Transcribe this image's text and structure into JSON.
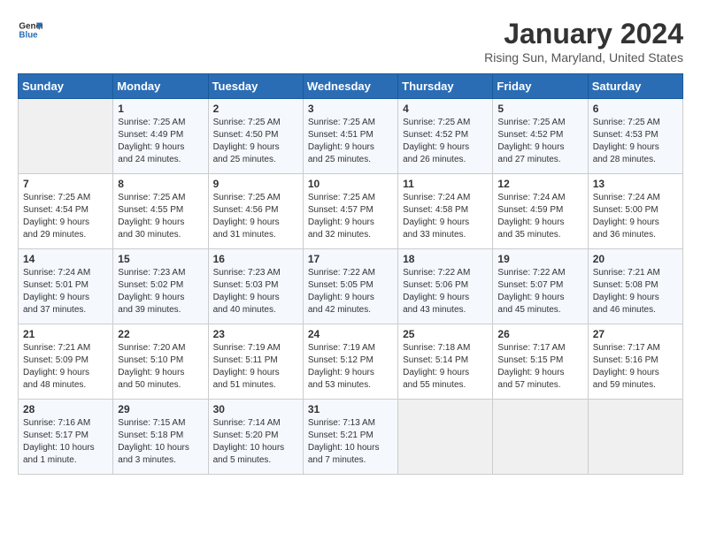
{
  "logo": {
    "line1": "General",
    "line2": "Blue"
  },
  "title": "January 2024",
  "location": "Rising Sun, Maryland, United States",
  "days_of_week": [
    "Sunday",
    "Monday",
    "Tuesday",
    "Wednesday",
    "Thursday",
    "Friday",
    "Saturday"
  ],
  "weeks": [
    [
      {
        "day": "",
        "info": ""
      },
      {
        "day": "1",
        "info": "Sunrise: 7:25 AM\nSunset: 4:49 PM\nDaylight: 9 hours\nand 24 minutes."
      },
      {
        "day": "2",
        "info": "Sunrise: 7:25 AM\nSunset: 4:50 PM\nDaylight: 9 hours\nand 25 minutes."
      },
      {
        "day": "3",
        "info": "Sunrise: 7:25 AM\nSunset: 4:51 PM\nDaylight: 9 hours\nand 25 minutes."
      },
      {
        "day": "4",
        "info": "Sunrise: 7:25 AM\nSunset: 4:52 PM\nDaylight: 9 hours\nand 26 minutes."
      },
      {
        "day": "5",
        "info": "Sunrise: 7:25 AM\nSunset: 4:52 PM\nDaylight: 9 hours\nand 27 minutes."
      },
      {
        "day": "6",
        "info": "Sunrise: 7:25 AM\nSunset: 4:53 PM\nDaylight: 9 hours\nand 28 minutes."
      }
    ],
    [
      {
        "day": "7",
        "info": "Sunrise: 7:25 AM\nSunset: 4:54 PM\nDaylight: 9 hours\nand 29 minutes."
      },
      {
        "day": "8",
        "info": "Sunrise: 7:25 AM\nSunset: 4:55 PM\nDaylight: 9 hours\nand 30 minutes."
      },
      {
        "day": "9",
        "info": "Sunrise: 7:25 AM\nSunset: 4:56 PM\nDaylight: 9 hours\nand 31 minutes."
      },
      {
        "day": "10",
        "info": "Sunrise: 7:25 AM\nSunset: 4:57 PM\nDaylight: 9 hours\nand 32 minutes."
      },
      {
        "day": "11",
        "info": "Sunrise: 7:24 AM\nSunset: 4:58 PM\nDaylight: 9 hours\nand 33 minutes."
      },
      {
        "day": "12",
        "info": "Sunrise: 7:24 AM\nSunset: 4:59 PM\nDaylight: 9 hours\nand 35 minutes."
      },
      {
        "day": "13",
        "info": "Sunrise: 7:24 AM\nSunset: 5:00 PM\nDaylight: 9 hours\nand 36 minutes."
      }
    ],
    [
      {
        "day": "14",
        "info": "Sunrise: 7:24 AM\nSunset: 5:01 PM\nDaylight: 9 hours\nand 37 minutes."
      },
      {
        "day": "15",
        "info": "Sunrise: 7:23 AM\nSunset: 5:02 PM\nDaylight: 9 hours\nand 39 minutes."
      },
      {
        "day": "16",
        "info": "Sunrise: 7:23 AM\nSunset: 5:03 PM\nDaylight: 9 hours\nand 40 minutes."
      },
      {
        "day": "17",
        "info": "Sunrise: 7:22 AM\nSunset: 5:05 PM\nDaylight: 9 hours\nand 42 minutes."
      },
      {
        "day": "18",
        "info": "Sunrise: 7:22 AM\nSunset: 5:06 PM\nDaylight: 9 hours\nand 43 minutes."
      },
      {
        "day": "19",
        "info": "Sunrise: 7:22 AM\nSunset: 5:07 PM\nDaylight: 9 hours\nand 45 minutes."
      },
      {
        "day": "20",
        "info": "Sunrise: 7:21 AM\nSunset: 5:08 PM\nDaylight: 9 hours\nand 46 minutes."
      }
    ],
    [
      {
        "day": "21",
        "info": "Sunrise: 7:21 AM\nSunset: 5:09 PM\nDaylight: 9 hours\nand 48 minutes."
      },
      {
        "day": "22",
        "info": "Sunrise: 7:20 AM\nSunset: 5:10 PM\nDaylight: 9 hours\nand 50 minutes."
      },
      {
        "day": "23",
        "info": "Sunrise: 7:19 AM\nSunset: 5:11 PM\nDaylight: 9 hours\nand 51 minutes."
      },
      {
        "day": "24",
        "info": "Sunrise: 7:19 AM\nSunset: 5:12 PM\nDaylight: 9 hours\nand 53 minutes."
      },
      {
        "day": "25",
        "info": "Sunrise: 7:18 AM\nSunset: 5:14 PM\nDaylight: 9 hours\nand 55 minutes."
      },
      {
        "day": "26",
        "info": "Sunrise: 7:17 AM\nSunset: 5:15 PM\nDaylight: 9 hours\nand 57 minutes."
      },
      {
        "day": "27",
        "info": "Sunrise: 7:17 AM\nSunset: 5:16 PM\nDaylight: 9 hours\nand 59 minutes."
      }
    ],
    [
      {
        "day": "28",
        "info": "Sunrise: 7:16 AM\nSunset: 5:17 PM\nDaylight: 10 hours\nand 1 minute."
      },
      {
        "day": "29",
        "info": "Sunrise: 7:15 AM\nSunset: 5:18 PM\nDaylight: 10 hours\nand 3 minutes."
      },
      {
        "day": "30",
        "info": "Sunrise: 7:14 AM\nSunset: 5:20 PM\nDaylight: 10 hours\nand 5 minutes."
      },
      {
        "day": "31",
        "info": "Sunrise: 7:13 AM\nSunset: 5:21 PM\nDaylight: 10 hours\nand 7 minutes."
      },
      {
        "day": "",
        "info": ""
      },
      {
        "day": "",
        "info": ""
      },
      {
        "day": "",
        "info": ""
      }
    ]
  ]
}
